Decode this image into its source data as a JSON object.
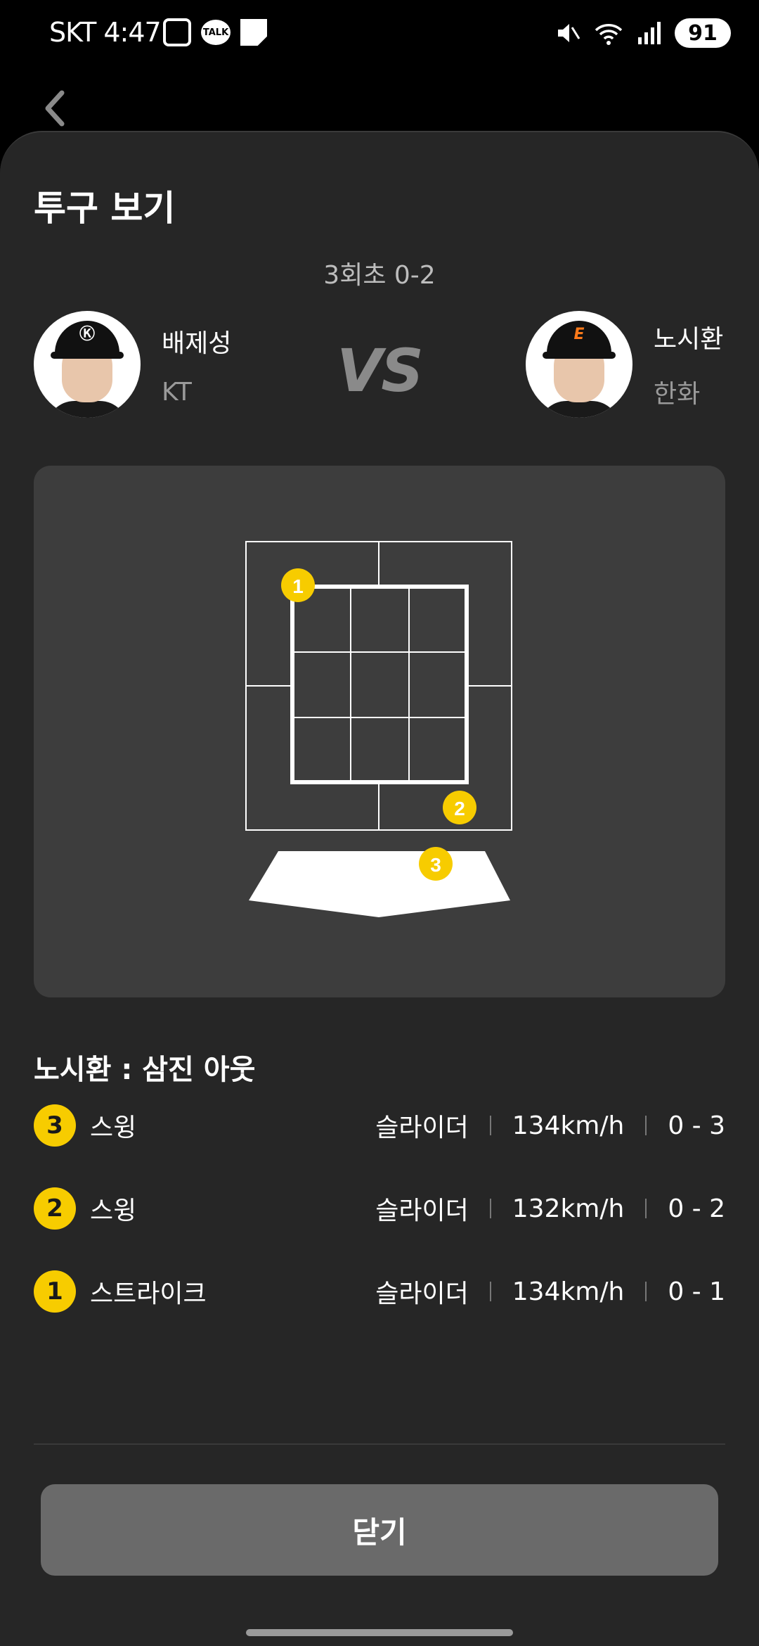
{
  "status_bar": {
    "carrier_time": "SKT 4:47",
    "talk": "TALK",
    "battery": "91"
  },
  "title": "투구 보기",
  "inning": "3회초 0-2",
  "players": {
    "left": {
      "name": "배제성",
      "team": "KT",
      "logo": "Ⓚ"
    },
    "right": {
      "name": "노시환",
      "team": "한화",
      "logo": "E"
    }
  },
  "vs": "VS",
  "zone_markers": [
    "1",
    "2",
    "3"
  ],
  "result": "노시환 : 삼진 아웃",
  "pitches": [
    {
      "num": "3",
      "type": "스윙",
      "pitch": "슬라이더",
      "speed": "134km/h",
      "count": "0 - 3"
    },
    {
      "num": "2",
      "type": "스윙",
      "pitch": "슬라이더",
      "speed": "132km/h",
      "count": "0 - 2"
    },
    {
      "num": "1",
      "type": "스트라이크",
      "pitch": "슬라이더",
      "speed": "134km/h",
      "count": "0 - 1"
    }
  ],
  "close_label": "닫기",
  "colors": {
    "background": "#262626",
    "panel": "#3d3d3d",
    "badge": "#f7cc00",
    "button": "#6a6a6a"
  }
}
